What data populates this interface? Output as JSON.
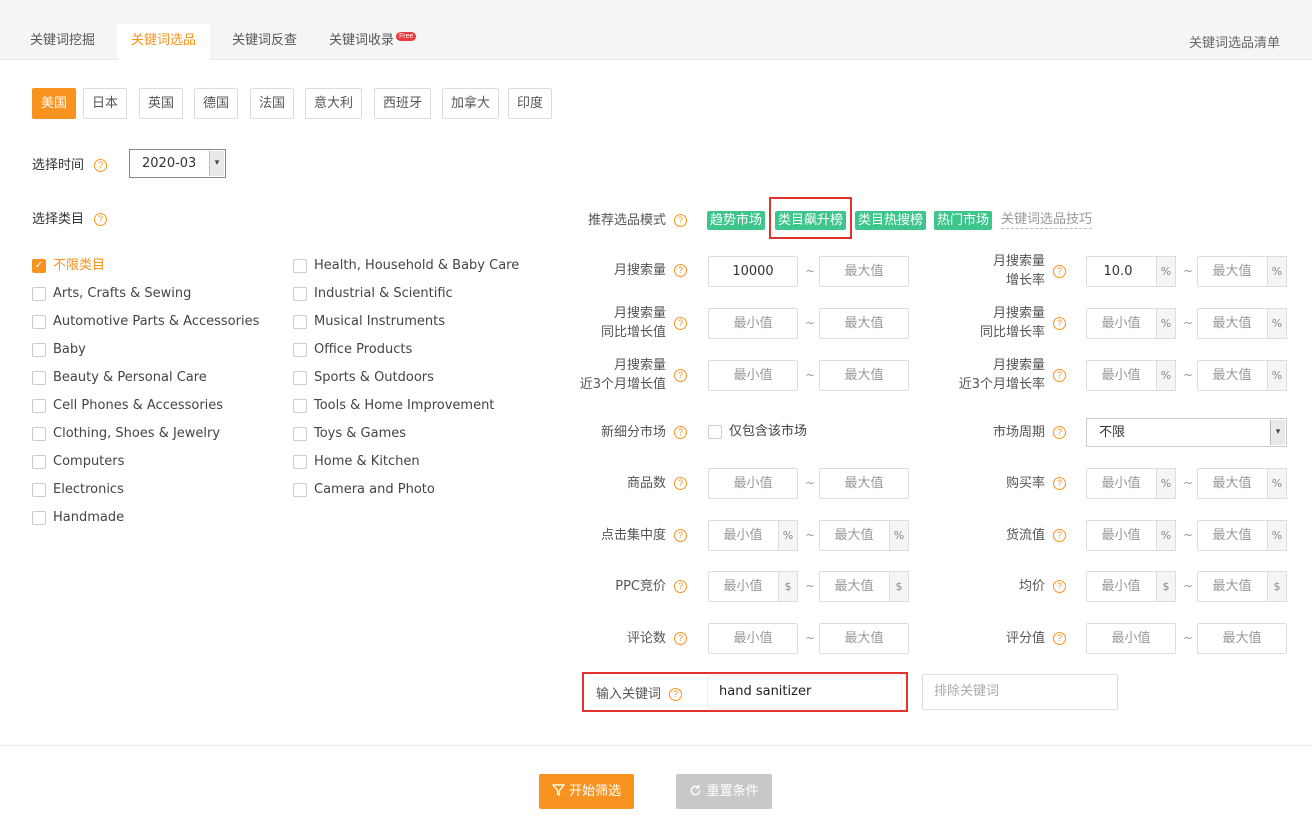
{
  "tabs": [
    {
      "label": "关键词挖掘"
    },
    {
      "label": "关键词选品"
    },
    {
      "label": "关键词反查"
    },
    {
      "label": "关键词收录",
      "badge": "Free"
    }
  ],
  "right_link": "关键词选品清单",
  "countries": [
    "美国",
    "日本",
    "英国",
    "德国",
    "法国",
    "意大利",
    "西班牙",
    "加拿大",
    "印度"
  ],
  "time": {
    "label": "选择时间",
    "value": "2020-03"
  },
  "category": {
    "label": "选择类目",
    "left": [
      "不限类目",
      "Arts, Crafts & Sewing",
      "Automotive Parts & Accessories",
      "Baby",
      "Beauty & Personal Care",
      "Cell Phones & Accessories",
      "Clothing, Shoes & Jewelry",
      "Computers",
      "Electronics",
      "Handmade"
    ],
    "right": [
      "Health, Household & Baby Care",
      "Industrial & Scientific",
      "Musical Instruments",
      "Office Products",
      "Sports & Outdoors",
      "Tools & Home Improvement",
      "Toys & Games",
      "Home & Kitchen",
      "Camera and Photo"
    ]
  },
  "mode": {
    "label": "推荐选品模式",
    "options": [
      "趋势市场",
      "类目飙升榜",
      "类目热搜榜",
      "热门市场"
    ],
    "tips": "关键词选品技巧"
  },
  "filters": {
    "search_volume": {
      "label": "月搜索量",
      "min": "10000",
      "max": "最大值"
    },
    "growth_rate": {
      "label1": "月搜索量",
      "label2": "增长率",
      "min": "10.0",
      "max": "最大值"
    },
    "yoy_value": {
      "label1": "月搜索量",
      "label2": "同比增长值",
      "min": "最小值",
      "max": "最大值"
    },
    "yoy_rate": {
      "label1": "月搜索量",
      "label2": "同比增长率",
      "min": "最小值",
      "max": "最大值"
    },
    "q3_value": {
      "label1": "月搜索量",
      "label2": "近3个月增长值",
      "min": "最小值",
      "max": "最大值"
    },
    "q3_rate": {
      "label1": "月搜索量",
      "label2": "近3个月增长率",
      "min": "最小值",
      "max": "最大值"
    },
    "new_market": {
      "label": "新细分市场",
      "checkbox": "仅包含该市场"
    },
    "market_cycle": {
      "label": "市场周期",
      "value": "不限"
    },
    "product_count": {
      "label": "商品数",
      "min": "最小值",
      "max": "最大值"
    },
    "purchase_rate": {
      "label": "购买率",
      "min": "最小值",
      "max": "最大值"
    },
    "click_conc": {
      "label": "点击集中度",
      "min": "最小值",
      "max": "最大值"
    },
    "gmv": {
      "label": "货流值",
      "min": "最小值",
      "max": "最大值"
    },
    "ppc": {
      "label": "PPC竞价",
      "min": "最小值",
      "max": "最大值"
    },
    "avg_price": {
      "label": "均价",
      "min": "最小值",
      "max": "最大值"
    },
    "reviews": {
      "label": "评论数",
      "min": "最小值",
      "max": "最大值"
    },
    "rating": {
      "label": "评分值",
      "min": "最小值",
      "max": "最大值"
    }
  },
  "units": {
    "percent": "%",
    "dollar": "$",
    "tilde": "~",
    "help": "?"
  },
  "keyword": {
    "label": "输入关键词",
    "value": "hand sanitizer",
    "exclude_placeholder": "排除关键词"
  },
  "buttons": {
    "start": "开始筛选",
    "reset": "重置条件"
  },
  "colors": {
    "accent": "#f7931e",
    "mode_green": "#3ec58c",
    "highlight_red": "#e4322f"
  }
}
